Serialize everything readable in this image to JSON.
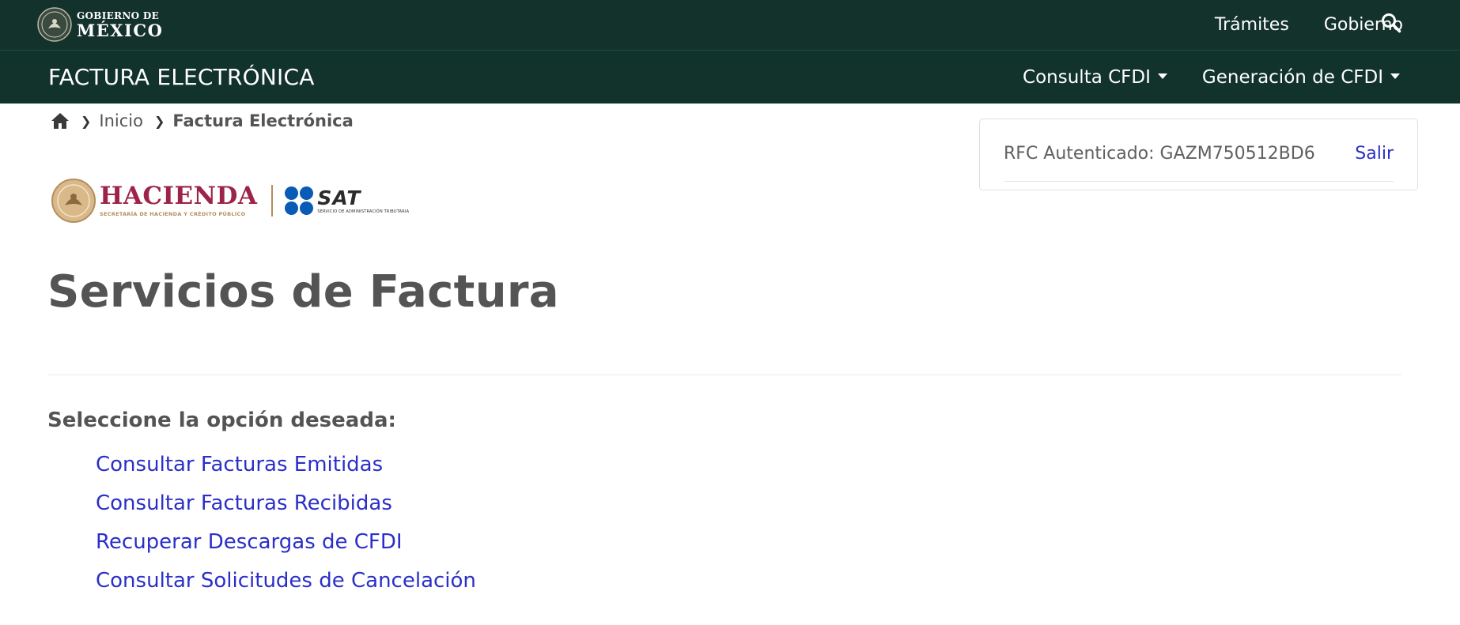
{
  "header": {
    "gob_line1": "GOBIERNO DE",
    "gob_line2": "MÉXICO",
    "nav": [
      {
        "label": "Trámites"
      },
      {
        "label": "Gobierno"
      }
    ],
    "search_icon": "search-icon"
  },
  "subheader": {
    "title": "FACTURA ELECTRÓNICA",
    "menus": [
      {
        "label": "Consulta CFDI"
      },
      {
        "label": "Generación de CFDI"
      }
    ]
  },
  "breadcrumb": {
    "home_icon": "home-icon",
    "items": [
      {
        "label": "Inicio"
      },
      {
        "label": "Factura Electrónica"
      }
    ]
  },
  "logos": {
    "hacienda_name": "HACIENDA",
    "hacienda_sub": "SECRETARÍA DE HACIENDA Y CRÉDITO PÚBLICO",
    "sat_name": "SAT",
    "sat_sub": "SERVICIO DE ADMINISTRACIÓN TRIBUTARIA"
  },
  "auth": {
    "rfc_label": "RFC Autenticado: GAZM750512BD6",
    "logout_label": "Salir"
  },
  "main": {
    "title": "Servicios de Factura",
    "select_label": "Seleccione la opción deseada:",
    "options": [
      {
        "label": "Consultar Facturas Emitidas"
      },
      {
        "label": "Consultar Facturas Recibidas"
      },
      {
        "label": "Recuperar Descargas de CFDI"
      },
      {
        "label": "Consultar Solicitudes de Cancelación"
      }
    ]
  },
  "colors": {
    "topbar_bg": "#13322b",
    "subbar_bg": "#12332c",
    "link": "#2b2fc8",
    "hacienda": "#9d2449",
    "gold": "#b38e5d",
    "sat_blue": "#0a5bb5"
  }
}
